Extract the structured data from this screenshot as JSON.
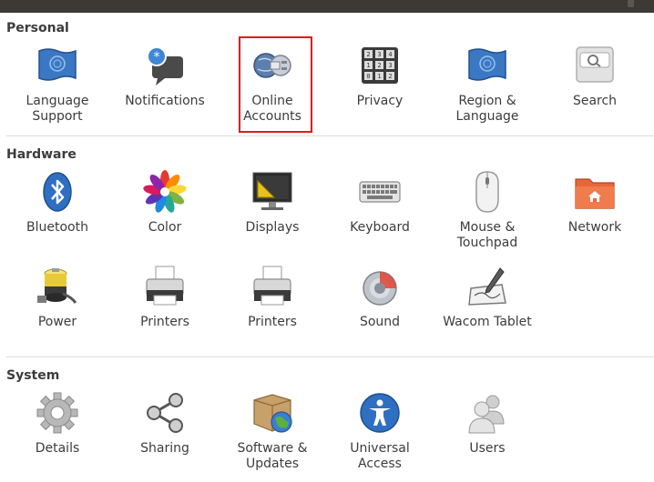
{
  "sections": {
    "personal": {
      "title": "Personal",
      "items": [
        {
          "label": "Language\nSupport",
          "icon": "flag-icon"
        },
        {
          "label": "Notifications",
          "icon": "notification-bubble-icon"
        },
        {
          "label": "Online\nAccounts",
          "icon": "online-accounts-globe-plug-icon"
        },
        {
          "label": "Privacy",
          "icon": "combination-lock-icon"
        },
        {
          "label": "Region &\nLanguage",
          "icon": "flag-icon"
        },
        {
          "label": "Search",
          "icon": "magnifier-icon"
        }
      ]
    },
    "hardware": {
      "title": "Hardware",
      "items": [
        {
          "label": "Bluetooth",
          "icon": "bluetooth-icon"
        },
        {
          "label": "Color",
          "icon": "color-flower-icon"
        },
        {
          "label": "Displays",
          "icon": "display-monitor-icon"
        },
        {
          "label": "Keyboard",
          "icon": "keyboard-icon"
        },
        {
          "label": "Mouse &\nTouchpad",
          "icon": "mouse-icon"
        },
        {
          "label": "Network",
          "icon": "network-folder-icon"
        },
        {
          "label": "Power",
          "icon": "battery-icon"
        },
        {
          "label": "Printers",
          "icon": "printer-icon"
        },
        {
          "label": "Printers",
          "icon": "printer-icon"
        },
        {
          "label": "Sound",
          "icon": "speaker-icon"
        },
        {
          "label": "Wacom Tablet",
          "icon": "tablet-pen-icon"
        }
      ]
    },
    "system": {
      "title": "System",
      "items": [
        {
          "label": "Details",
          "icon": "gear-icon"
        },
        {
          "label": "Sharing",
          "icon": "share-icon"
        },
        {
          "label": "Software &\nUpdates",
          "icon": "package-globe-icon"
        },
        {
          "label": "Universal\nAccess",
          "icon": "accessibility-icon"
        },
        {
          "label": "Users",
          "icon": "users-icon"
        }
      ]
    }
  },
  "colors": {
    "highlight": "#e0191b",
    "topbar": "#3d3a36"
  }
}
